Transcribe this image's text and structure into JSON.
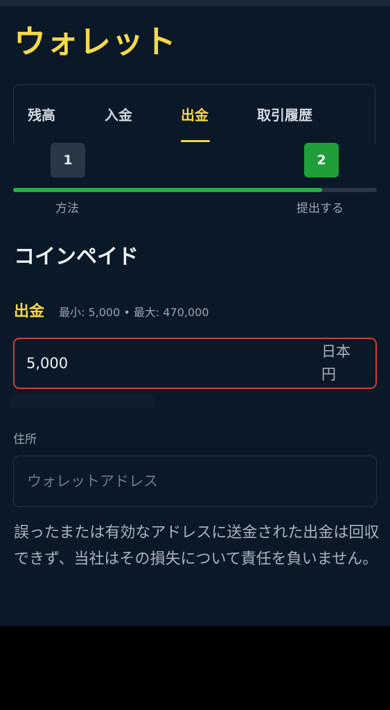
{
  "header": {
    "title": "ウォレット"
  },
  "tabs": [
    {
      "label": "残高",
      "active": false
    },
    {
      "label": "入金",
      "active": false
    },
    {
      "label": "出金",
      "active": true
    },
    {
      "label": "取引履歴",
      "active": false
    }
  ],
  "stepper": {
    "steps": [
      {
        "number": "1",
        "label": "方法"
      },
      {
        "number": "2",
        "label": "提出する"
      }
    ],
    "current_step": 2,
    "progress_fraction": 0.85
  },
  "method": {
    "title": "コインペイド"
  },
  "amount": {
    "label": "出金",
    "limits": "最小: 5,000 • 最大: 470,000",
    "value": "5,000",
    "currency": "日本円"
  },
  "address": {
    "label": "住所",
    "placeholder": "ウォレットアドレス",
    "value": ""
  },
  "disclaimer": "誤ったまたは有効なアドレスに送金された出金は回収できず、当社はその損失について責任を負いません。",
  "colors": {
    "background": "#0b1827",
    "accent": "#f5d94b",
    "success": "#27b043",
    "error_border": "#d0403a"
  }
}
